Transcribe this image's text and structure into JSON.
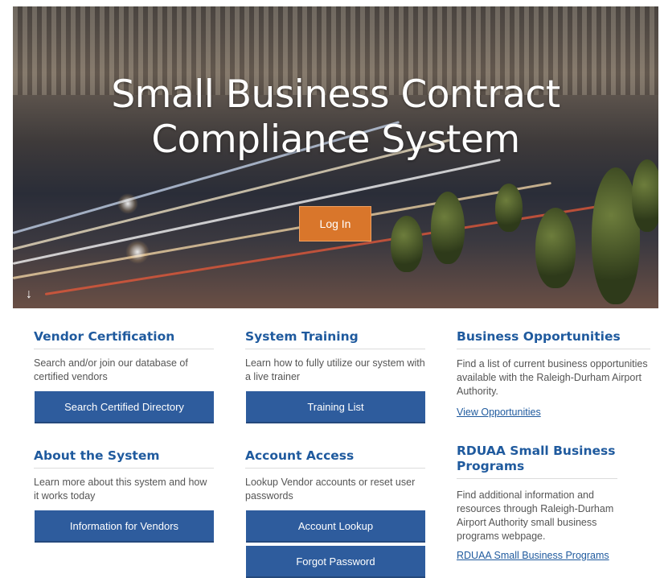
{
  "hero": {
    "title_line1": "Small Business Contract",
    "title_line2": "Compliance System",
    "login_label": "Log In",
    "scroll_icon": "arrow-down-icon"
  },
  "cards": {
    "vendor_certification": {
      "title": "Vendor Certification",
      "desc": "Search and/or join our database of certified vendors",
      "button": "Search Certified Directory"
    },
    "system_training": {
      "title": "System Training",
      "desc": "Learn how to fully utilize our system with a live trainer",
      "button": "Training List"
    },
    "business_opportunities": {
      "title": "Business Opportunities",
      "desc": "Find a list of current business opportunities available with the Raleigh-Durham Airport Authority.",
      "link": "View Opportunities"
    },
    "about_system": {
      "title": "About the System",
      "desc": "Learn more about this system and how it works today",
      "button": "Information for Vendors"
    },
    "account_access": {
      "title": "Account Access",
      "desc": "Lookup Vendor accounts or reset user passwords",
      "button1": "Account Lookup",
      "button2": "Forgot Password"
    },
    "rduaa_programs": {
      "title": "RDUAA Small Business Programs",
      "desc": "Find additional information and resources through Raleigh-Durham Airport Authority small business programs webpage.",
      "link": "RDUAA Small Business Programs"
    }
  },
  "colors": {
    "accent_blue": "#2e5c9d",
    "title_blue": "#1f5a9e",
    "login_orange": "#d9762b"
  }
}
